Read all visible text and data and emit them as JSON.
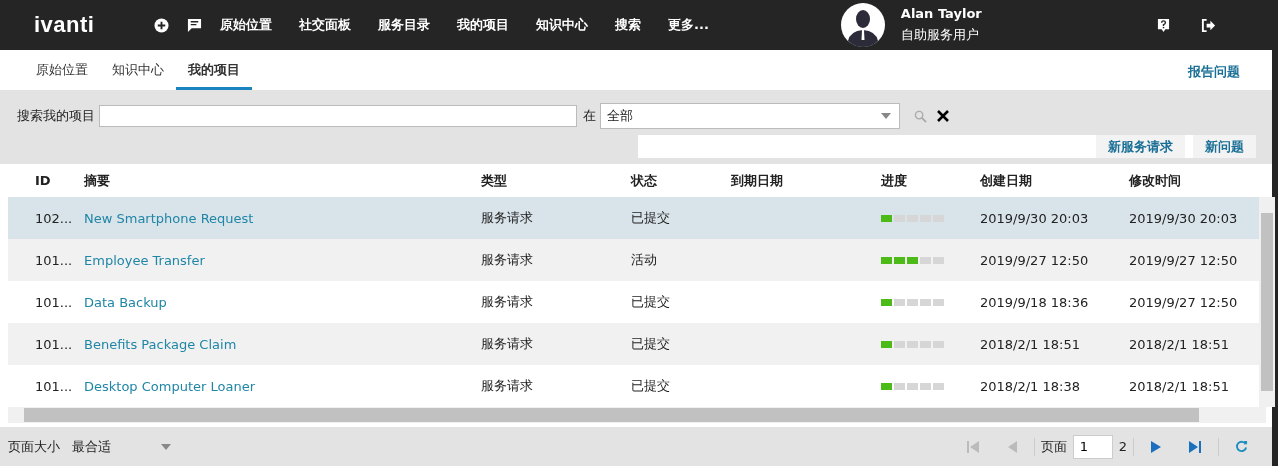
{
  "header": {
    "logo": "ivanti",
    "nav": [
      {
        "label": "原始位置"
      },
      {
        "label": "社交面板"
      },
      {
        "label": "服务目录"
      },
      {
        "label": "我的项目"
      },
      {
        "label": "知识中心"
      },
      {
        "label": "搜索"
      },
      {
        "label": "更多..."
      }
    ],
    "user": {
      "name": "Alan Taylor",
      "role": "自助服务用户"
    }
  },
  "tabs": [
    {
      "label": "原始位置",
      "selected": false
    },
    {
      "label": "知识中心",
      "selected": false
    },
    {
      "label": "我的项目",
      "selected": true
    }
  ],
  "report_link": "报告问题",
  "search": {
    "label": "搜索我的项目",
    "in_label": "在",
    "scope": "全部"
  },
  "actions": [
    "新服务请求",
    "新问题"
  ],
  "table": {
    "columns": [
      "ID",
      "摘要",
      "类型",
      "状态",
      "到期日期",
      "进度",
      "创建日期",
      "修改时间"
    ],
    "rows": [
      {
        "id": "102...",
        "summary": "New Smartphone Request",
        "type": "服务请求",
        "status": "已提交",
        "level": 0.2,
        "created": "2019/9/30 20:03",
        "modified": "2019/9/30 20:03",
        "selected": true
      },
      {
        "id": "101...",
        "summary": "Employee Transfer",
        "type": "服务请求",
        "status": "活动",
        "level": 0.6,
        "created": "2019/9/27 12:50",
        "modified": "2019/9/27 12:50",
        "selected": false
      },
      {
        "id": "101...",
        "summary": "Data Backup",
        "type": "服务请求",
        "status": "已提交",
        "level": 0.2,
        "created": "2019/9/18 18:36",
        "modified": "2019/9/27 12:50",
        "selected": false
      },
      {
        "id": "101...",
        "summary": "Benefits Package Claim",
        "type": "服务请求",
        "status": "已提交",
        "level": 0.2,
        "created": "2018/2/1 18:51",
        "modified": "2018/2/1 18:51",
        "selected": false
      },
      {
        "id": "101...",
        "summary": "Desktop Computer Loaner",
        "type": "服务请求",
        "status": "已提交",
        "level": 0.2,
        "created": "2018/2/1 18:38",
        "modified": "2018/2/1 18:51",
        "selected": false
      }
    ]
  },
  "footer": {
    "page_size_label": "页面大小",
    "page_size": "最合适",
    "page_label": "页面",
    "page": "1",
    "page_count": "2"
  }
}
